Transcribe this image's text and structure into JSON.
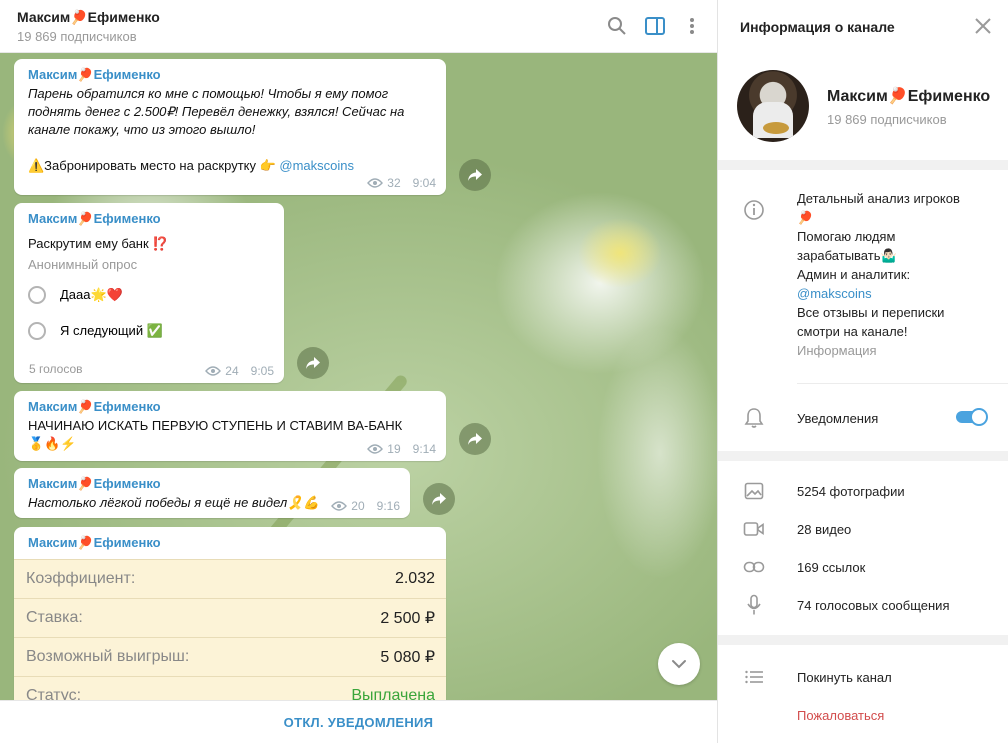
{
  "chat": {
    "title": "Максим🏓Ефименко",
    "subscribers": "19 869 подписчиков",
    "messages": [
      {
        "author": "Максим🏓Ефименко",
        "text": "Парень обратился ко мне с помощью! Чтобы я ему помог поднять денег с 2.500₽! Перевёл денежку, взялся! Сейчас на канале покажу, что из этого вышло!",
        "promo": "⚠️Забронировать место на раскрутку 👉 ",
        "promo_link": "@makscoins",
        "views": "32",
        "time": "9:04"
      },
      {
        "author": "Максим🏓Ефименко",
        "question": "Раскрутим ему банк ⁉️",
        "poll_type": "Анонимный опрос",
        "options": [
          "Дааа🌟❤️",
          "Я следующий ✅"
        ],
        "votes": "5 голосов",
        "views": "24",
        "time": "9:05"
      },
      {
        "author": "Максим🏓Ефименко",
        "text": "НАЧИНАЮ ИСКАТЬ ПЕРВУЮ СТУПЕНЬ И СТАВИМ ВА-БАНК🥇🔥⚡",
        "views": "19",
        "time": "9:14"
      },
      {
        "author": "Максим🏓Ефименко",
        "text": "Настолько лёгкой победы я ещё не видел🎗️💪",
        "views": "20",
        "time": "9:16"
      },
      {
        "author": "Максим🏓Ефименко",
        "rows": [
          {
            "label": "Коэффициент:",
            "value": "2.032"
          },
          {
            "label": "Ставка:",
            "value": "2 500 ₽"
          },
          {
            "label": "Возможный выигрыш:",
            "value": "5 080 ₽"
          },
          {
            "label": "Статус:",
            "value": "Выплачена"
          }
        ]
      }
    ],
    "footer_button": "ОТКЛ. УВЕДОМЛЕНИЯ"
  },
  "panel": {
    "title": "Информация о канале",
    "name": "Максим🏓Ефименко",
    "subscribers": "19 869 подписчиков",
    "description_lines": [
      "Детальный анализ игроков",
      "🏓",
      "Помогаю людям",
      "зарабатывать🤷🏻‍♂️",
      "Админ и аналитик:",
      "@makscoins",
      "Все отзывы и переписки",
      "смотри на канале!"
    ],
    "description_label": "Информация",
    "notifications_label": "Уведомления",
    "notifications_on": true,
    "media": [
      {
        "icon": "photo-icon",
        "label": "5254 фотографии"
      },
      {
        "icon": "video-icon",
        "label": "28 видео"
      },
      {
        "icon": "link-icon",
        "label": "169 ссылок"
      },
      {
        "icon": "microphone-icon",
        "label": "74 голосовых сообщения"
      }
    ],
    "leave_label": "Покинуть канал",
    "report_label": "Пожаловаться"
  },
  "colors": {
    "accent": "#3a8fc8",
    "toggle": "#4aa3df",
    "status_paid": "#3aa53a",
    "report": "#d24c4c",
    "bet_table_bg": "#fcf3d7"
  }
}
